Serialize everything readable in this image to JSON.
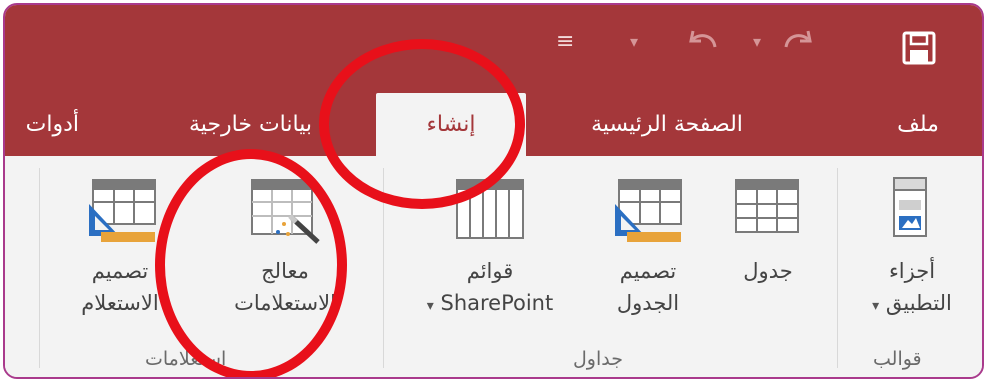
{
  "qat": {
    "save_icon": "save-icon",
    "dropdown_glyph": "≡",
    "separator_glyph": "▾",
    "undo_icon": "undo-icon",
    "redo_icon": "redo-icon"
  },
  "tabs": {
    "file": "ملف",
    "home": "الصفحة الرئيسية",
    "create": "إنشاء",
    "external_data": "بيانات خارجية",
    "database_tools": "أدوات"
  },
  "ribbon": {
    "templates": {
      "app_parts_line1": "أجزاء",
      "app_parts_line2": "التطبيق",
      "group_label": "قوالب"
    },
    "tables": {
      "table": "جدول",
      "table_design_line1": "تصميم",
      "table_design_line2": "الجدول",
      "sharepoint_line1": "قوائم",
      "sharepoint_line2": "SharePoint",
      "group_label": "جداول"
    },
    "queries": {
      "query_wizard_line1": "معالج",
      "query_wizard_line2": "الاستعلامات",
      "query_design_line1": "تصميم",
      "query_design_line2": "الاستعلام",
      "group_label": "استعلامات"
    }
  },
  "colors": {
    "title_bar": "#a4373a",
    "active_tab_text": "#a4373a",
    "ribbon_bg": "#f3f3f3",
    "annotation": "#e8101a",
    "frame_border": "#a93a8c"
  }
}
